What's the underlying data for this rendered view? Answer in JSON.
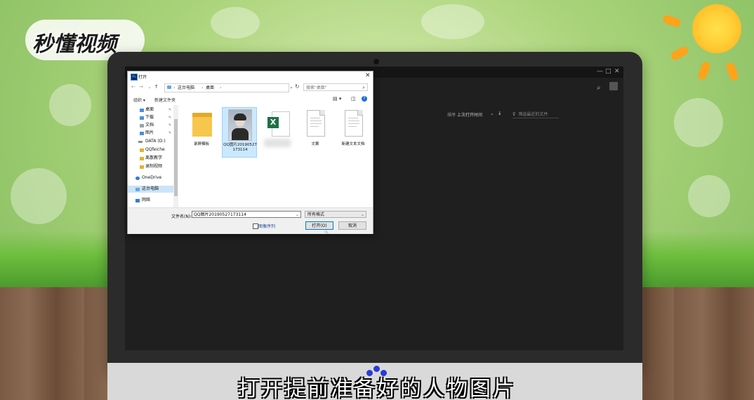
{
  "brand": {
    "logo_text": "秒懂视频"
  },
  "caption": "打开提前准备好的人物图片",
  "dialog": {
    "title": "打开",
    "app_icon_text": "Ps",
    "address": {
      "segments": [
        "这台电脑",
        "桌面"
      ]
    },
    "search_placeholder": "搜索\"桌面\"",
    "toolbar": {
      "organize": "组织 ▾",
      "new_folder": "新建文件夹"
    },
    "sidebar": [
      {
        "label": "桌面",
        "icon_color": "#4a90d9",
        "pinned": true
      },
      {
        "label": "下载",
        "icon_color": "#4a90d9",
        "pinned": true
      },
      {
        "label": "文档",
        "icon_color": "#9aa3ad",
        "pinned": true
      },
      {
        "label": "图片",
        "icon_color": "#4a90d9",
        "pinned": true
      },
      {
        "label": "DATA (D:)",
        "icon_color": "#8c8c8c",
        "pinned": false
      },
      {
        "label": "QQfeiche",
        "icon_color": "#e8b030",
        "pinned": false
      },
      {
        "label": "离散教学",
        "icon_color": "#e8b030",
        "pinned": false
      },
      {
        "label": "录制视频",
        "icon_color": "#e8b030",
        "pinned": false
      },
      {
        "label": "OneDrive",
        "icon_color": "#2f7fd6",
        "pinned": false
      },
      {
        "label": "这台电脑",
        "icon_color": "#6aa8dd",
        "pinned": false,
        "selected": true
      },
      {
        "label": "网络",
        "icon_color": "#2f7fd6",
        "pinned": false
      }
    ],
    "files": [
      {
        "label": "录屏模板",
        "kind": "folder"
      },
      {
        "label": "QQ图片20190527173114",
        "kind": "photo",
        "selected": true
      },
      {
        "label": "",
        "kind": "excel"
      },
      {
        "label": "文案",
        "kind": "doc"
      },
      {
        "label": "新建文本文档",
        "kind": "doc"
      }
    ],
    "filename_label": "文件名(N):",
    "filename_value": "QQ图片20190527173114",
    "filetype_value": "所有格式",
    "sequence_label": "图像序列",
    "open_button": "打开(O)",
    "cancel_button": "取消"
  },
  "photoshop": {
    "sort_label": "排序",
    "sort_value": "上次打开时间",
    "filter_placeholder": "筛选最近的文件"
  }
}
